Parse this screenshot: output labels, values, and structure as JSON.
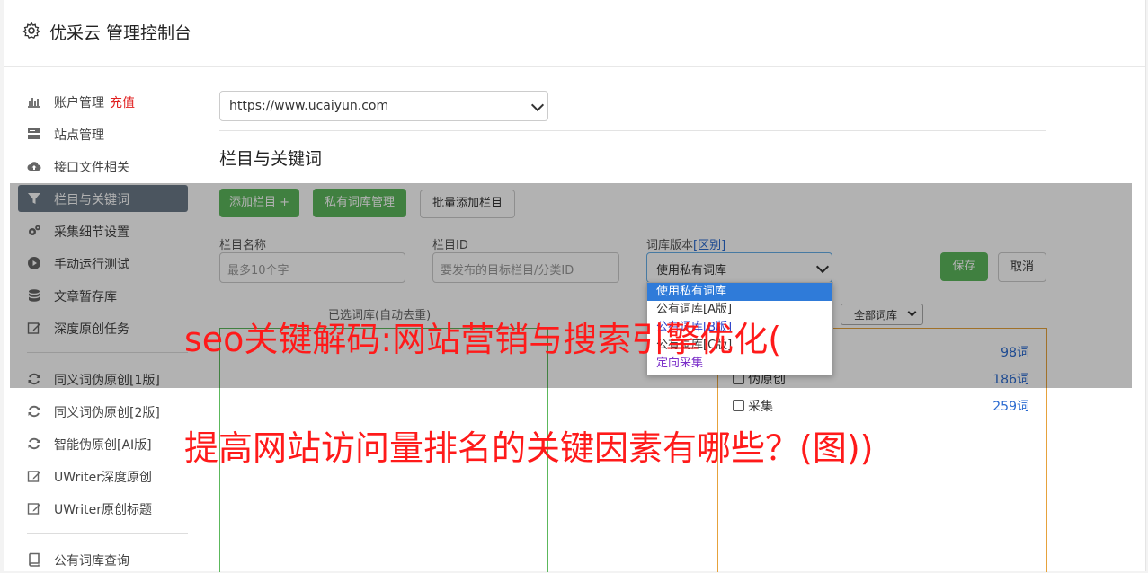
{
  "header": {
    "title": "优采云 管理控制台",
    "icon": "gear-icon"
  },
  "sidebar": {
    "items": [
      {
        "label": "账户管理",
        "extra": "充值",
        "icon": "bar-chart-icon"
      },
      {
        "label": "站点管理",
        "icon": "server-icon"
      },
      {
        "label": "接口文件相关",
        "icon": "cloud-upload-icon"
      },
      {
        "label": "栏目与关键词",
        "icon": "filter-icon",
        "active": true
      },
      {
        "label": "采集细节设置",
        "icon": "cogs-icon"
      },
      {
        "label": "手动运行测试",
        "icon": "play-circle-icon"
      },
      {
        "label": "文章暂存库",
        "icon": "database-icon"
      },
      {
        "label": "深度原创任务",
        "icon": "edit-icon"
      },
      {
        "label": "同义词伪原创[1版]",
        "icon": "refresh-icon"
      },
      {
        "label": "同义词伪原创[2版]",
        "icon": "refresh-icon"
      },
      {
        "label": "智能伪原创[AI版]",
        "icon": "refresh-icon"
      },
      {
        "label": "UWriter深度原创",
        "icon": "edit-icon"
      },
      {
        "label": "UWriter原创标题",
        "icon": "edit-icon"
      },
      {
        "label": "公有词库查询",
        "icon": "book-icon"
      }
    ]
  },
  "site": {
    "selected": "https://www.ucaiyun.com"
  },
  "section": {
    "title": "栏目与关键词"
  },
  "toolbar": {
    "add_column": "添加栏目 +",
    "private_lib": "私有词库管理",
    "bulk_add": "批量添加栏目"
  },
  "form": {
    "name_label": "栏目名称",
    "name_placeholder": "最多10个字",
    "id_label": "栏目ID",
    "id_placeholder": "要发布的目标栏目/分类ID",
    "version_label": "词库版本",
    "version_link": "[区别]",
    "version_selected": "使用私有词库",
    "save": "保存",
    "cancel": "取消"
  },
  "version_options": [
    "使用私有词库",
    "公有词库[A版]",
    "公有词库[B版]",
    "公有词库[C版]",
    "定向采集"
  ],
  "selected_panel": {
    "label": "已选词库(自动去重)"
  },
  "library_filter": {
    "selected": "全部词库"
  },
  "libraries": [
    {
      "name": "",
      "count": "98词"
    },
    {
      "name": "伪原创",
      "count": "186词"
    },
    {
      "name": "采集",
      "count": "259词"
    }
  ],
  "overlay_text": {
    "line1": "seo关键解码:网站营销与搜索引擎优化(",
    "line2": "提高网站访问量排名的关键因素有哪些？(图))"
  },
  "colors": {
    "accent_green": "#5cb85c",
    "active_nav": "#6c7a89",
    "link_blue": "#2a6ad0",
    "headline_red": "#ff1a1a"
  }
}
